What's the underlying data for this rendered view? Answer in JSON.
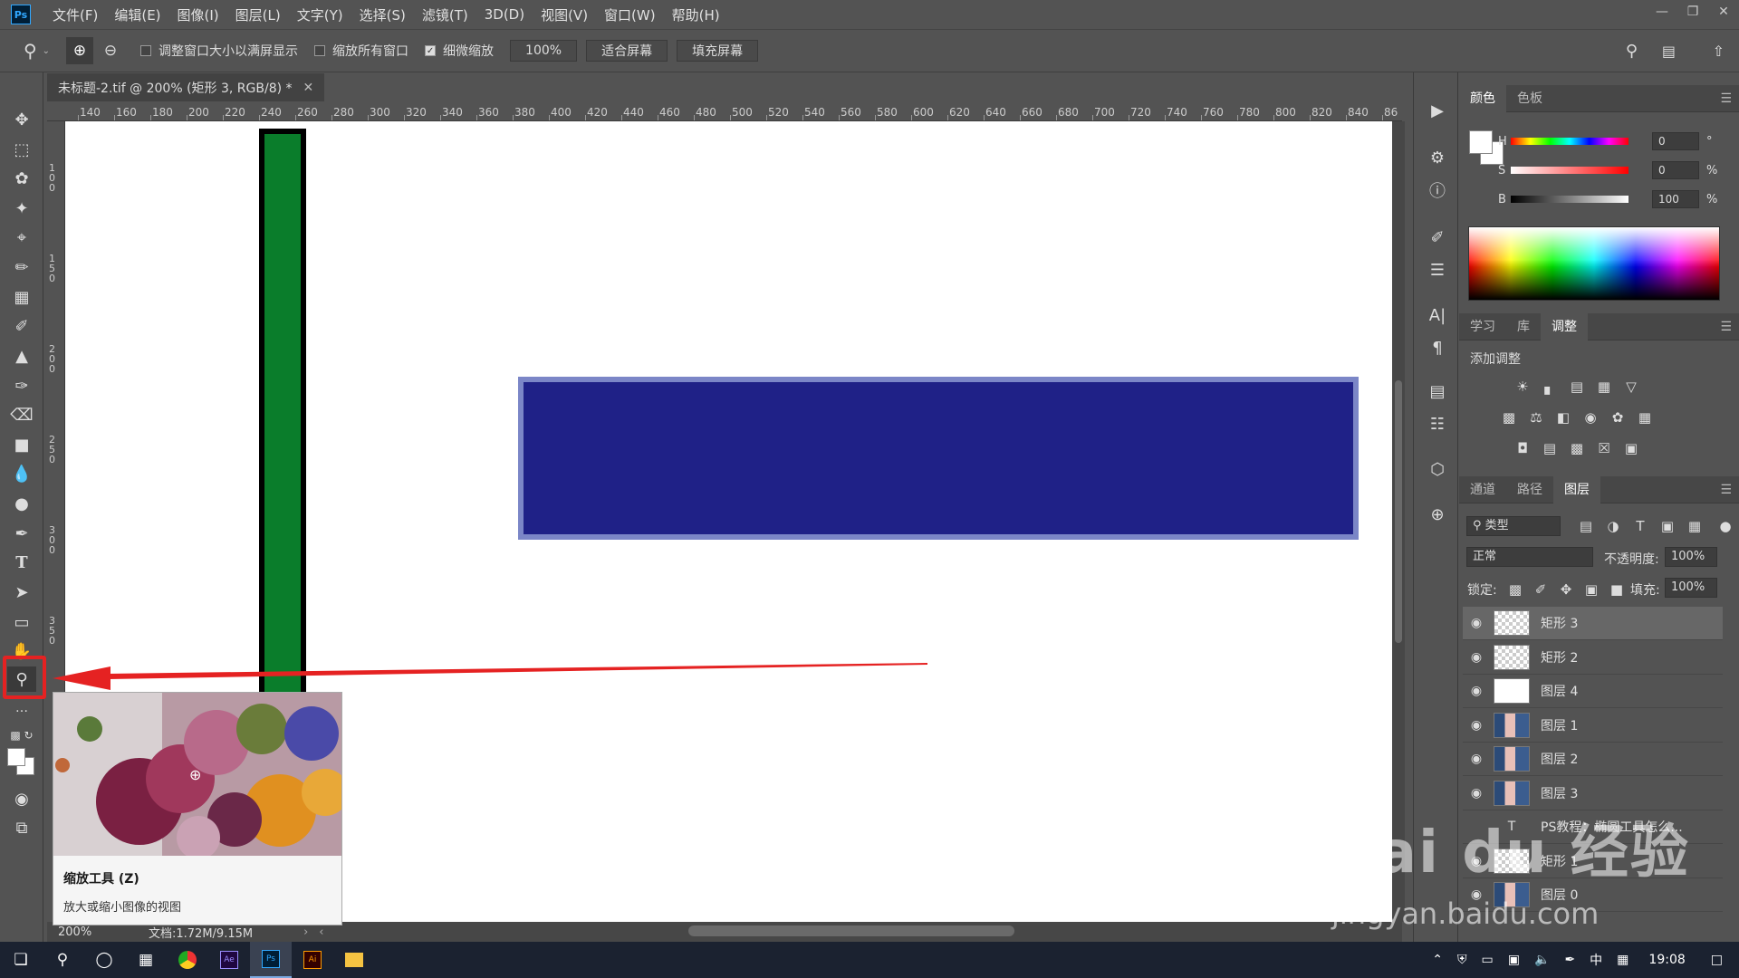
{
  "app": {
    "logo": "Ps"
  },
  "menu": [
    "文件(F)",
    "编辑(E)",
    "图像(I)",
    "图层(L)",
    "文字(Y)",
    "选择(S)",
    "滤镜(T)",
    "3D(D)",
    "视图(V)",
    "窗口(W)",
    "帮助(H)"
  ],
  "options": {
    "resize_windows": "调整窗口大小以满屏显示",
    "zoom_all": "缩放所有窗口",
    "scrubby_zoom": "细微缩放",
    "zoom_value": "100%",
    "fit_screen": "适合屏幕",
    "fill_screen": "填充屏幕"
  },
  "document": {
    "tab_title": "未标题-2.tif @ 200% (矩形 3, RGB/8) *"
  },
  "ruler": {
    "h_ticks": [
      "140",
      "160",
      "180",
      "200",
      "220",
      "240",
      "260",
      "280",
      "300",
      "320",
      "340",
      "360",
      "380",
      "400",
      "420",
      "440",
      "460",
      "480",
      "500",
      "520",
      "540",
      "560",
      "580",
      "600",
      "620",
      "640",
      "660",
      "680",
      "700",
      "720",
      "740",
      "760",
      "780",
      "800",
      "820",
      "840",
      "86"
    ],
    "v_ticks": [
      "100",
      "150",
      "200",
      "250",
      "300",
      "350"
    ]
  },
  "tooltip": {
    "title": "缩放工具 (Z)",
    "desc": "放大或缩小图像的视图"
  },
  "status": {
    "zoom": "200%",
    "doc": "文档:1.72M/9.15M"
  },
  "color_panel": {
    "tabs": [
      "颜色",
      "色板"
    ],
    "h_label": "H",
    "h_value": "0",
    "h_unit": "°",
    "s_label": "S",
    "s_value": "0",
    "s_unit": "%",
    "b_label": "B",
    "b_value": "100",
    "b_unit": "%"
  },
  "adjust_panel": {
    "tabs": [
      "学习",
      "库",
      "调整"
    ],
    "heading": "添加调整"
  },
  "layers_panel": {
    "tabs": [
      "通道",
      "路径",
      "图层"
    ],
    "filter": "类型",
    "blend_mode": "正常",
    "opacity_label": "不透明度:",
    "opacity": "100%",
    "lock_label": "锁定:",
    "fill_label": "填充:",
    "fill": "100%",
    "layers": [
      {
        "name": "矩形 3",
        "thumb": "trans",
        "selected": true
      },
      {
        "name": "矩形 2",
        "thumb": "trans",
        "selected": false
      },
      {
        "name": "图层 4",
        "thumb": "white",
        "selected": false
      },
      {
        "name": "图层 1",
        "thumb": "photo",
        "selected": false
      },
      {
        "name": "图层 2",
        "thumb": "photo",
        "selected": false
      },
      {
        "name": "图层 3",
        "thumb": "photo",
        "selected": false
      },
      {
        "name": "PS教程：椭圆工具怎么...",
        "thumb": "text",
        "selected": false
      },
      {
        "name": "矩形 1",
        "thumb": "trans",
        "selected": false
      },
      {
        "name": "图层 0",
        "thumb": "photo",
        "selected": false
      }
    ]
  },
  "taskbar": {
    "time": "19:08",
    "ime": "中"
  },
  "watermark": {
    "brand": "Bai du 经验",
    "url": "jingyan.baidu.com"
  },
  "colors": {
    "accent": "#31a8ff",
    "arrow": "#e52222",
    "green_rect": "#0a7d2b",
    "blue_rect": "#1f2187",
    "blue_border": "#7b86c7"
  }
}
